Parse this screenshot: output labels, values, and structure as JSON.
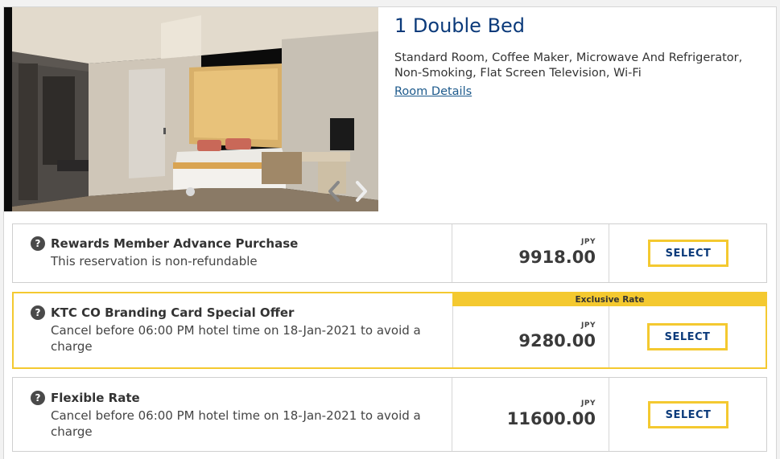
{
  "room": {
    "title": "1 Double Bed",
    "description": "Standard Room, Coffee Maker, Microwave And Refrigerator, Non-Smoking, Flat Screen Television, Wi-Fi",
    "details_link": "Room Details"
  },
  "gallery": {
    "prev_icon": "chevron-left-icon",
    "next_icon": "chevron-right-icon"
  },
  "rates": [
    {
      "name": "Rewards Member Advance Purchase",
      "note": "This reservation is non-refundable",
      "currency": "JPY",
      "amount": "9918.00",
      "button": "SELECT"
    },
    {
      "name": "KTC CO Branding Card Special Offer",
      "note": "Cancel before 06:00 PM hotel time on 18-Jan-2021 to avoid a charge",
      "badge": "Exclusive Rate",
      "currency": "JPY",
      "amount": "9280.00",
      "button": "SELECT"
    },
    {
      "name": "Flexible Rate",
      "note": "Cancel before 06:00 PM hotel time on 18-Jan-2021 to avoid a charge",
      "currency": "JPY",
      "amount": "11600.00",
      "button": "SELECT"
    }
  ],
  "colors": {
    "accent": "#f4c930",
    "title": "#0b3a7a",
    "link": "#1d5a8c"
  }
}
